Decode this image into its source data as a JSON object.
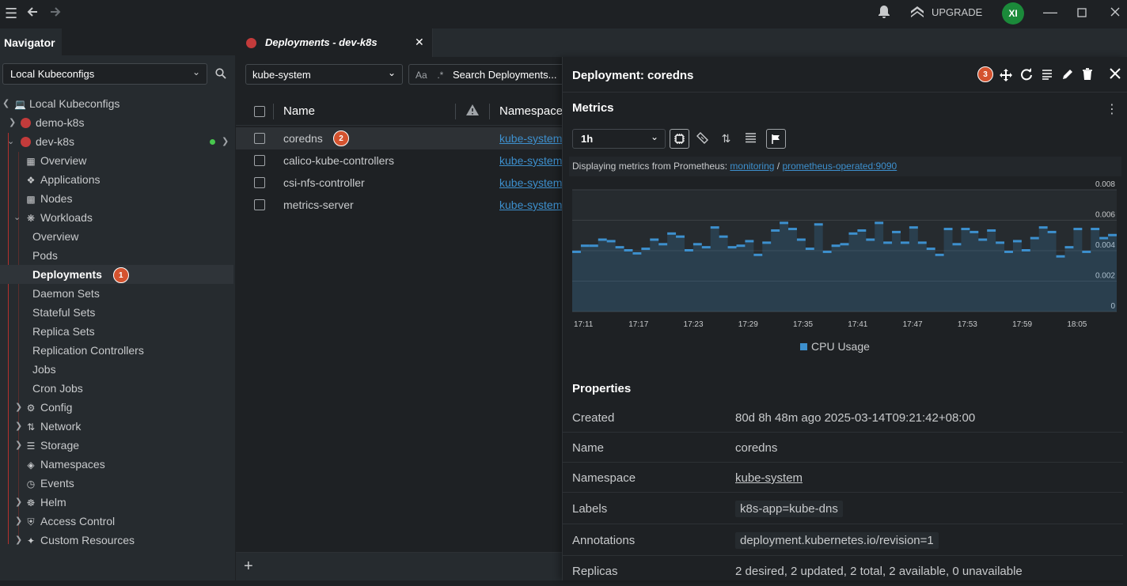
{
  "topbar": {
    "upgrade_label": "UPGRADE",
    "avatar_initials": "XI"
  },
  "navigator": {
    "tab_label": "Navigator",
    "kubeconfig_select": "Local Kubeconfigs",
    "tree": {
      "root": "Local Kubeconfigs",
      "cluster1": "demo-k8s",
      "cluster2": "dev-k8s",
      "overview": "Overview",
      "applications": "Applications",
      "nodes": "Nodes",
      "workloads": "Workloads",
      "workloads_items": [
        "Overview",
        "Pods",
        "Deployments",
        "Daemon Sets",
        "Stateful Sets",
        "Replica Sets",
        "Replication Controllers",
        "Jobs",
        "Cron Jobs"
      ],
      "config": "Config",
      "network": "Network",
      "storage": "Storage",
      "namespaces": "Namespaces",
      "events": "Events",
      "helm": "Helm",
      "access_control": "Access Control",
      "custom_resources": "Custom Resources"
    },
    "badge": "1"
  },
  "main": {
    "tab_label": "Deployments - dev-k8s",
    "namespace_select": "kube-system",
    "search_placeholder": "Search Deployments...",
    "search_prefix": "Aa",
    "columns": {
      "name": "Name",
      "namespace": "Namespace"
    },
    "rows": [
      {
        "name": "coredns",
        "namespace": "kube-system"
      },
      {
        "name": "calico-kube-controllers",
        "namespace": "kube-system"
      },
      {
        "name": "csi-nfs-controller",
        "namespace": "kube-system"
      },
      {
        "name": "metrics-server",
        "namespace": "kube-system"
      }
    ],
    "row_badge": "2"
  },
  "drawer": {
    "title": "Deployment: coredns",
    "badge": "3",
    "metrics_title": "Metrics",
    "range": "1h",
    "prom_prefix": "Displaying metrics from Prometheus: ",
    "prom_ns": "monitoring",
    "prom_sep": " / ",
    "prom_svc": "prometheus-operated:9090",
    "legend": "CPU Usage",
    "properties_title": "Properties",
    "properties": [
      {
        "key": "Created",
        "value": "80d 8h 48m ago 2025-03-14T09:21:42+08:00"
      },
      {
        "key": "Name",
        "value": "coredns"
      },
      {
        "key": "Namespace",
        "value": "kube-system"
      },
      {
        "key": "Labels",
        "value": "k8s-app=kube-dns"
      },
      {
        "key": "Annotations",
        "value": "deployment.kubernetes.io/revision=1"
      },
      {
        "key": "Replicas",
        "value": "2 desired, 2 updated, 2 total, 2 available, 0 unavailable"
      }
    ]
  },
  "chart_data": {
    "type": "area",
    "series_color": "#3d90ce",
    "x_ticks": [
      "17:11",
      "17:17",
      "17:23",
      "17:29",
      "17:35",
      "17:41",
      "17:47",
      "17:53",
      "17:59",
      "18:05"
    ],
    "y_ticks": [
      "0",
      "0.002",
      "0.004",
      "0.006",
      "0.008"
    ],
    "ylim": [
      0,
      0.008
    ],
    "legend": "CPU Usage",
    "values": [
      0.0039,
      0.0043,
      0.0043,
      0.0047,
      0.0046,
      0.0042,
      0.004,
      0.0038,
      0.0041,
      0.0047,
      0.0044,
      0.0051,
      0.0049,
      0.004,
      0.0044,
      0.0042,
      0.0055,
      0.0049,
      0.0042,
      0.0043,
      0.0046,
      0.0037,
      0.0045,
      0.0053,
      0.0058,
      0.0054,
      0.0047,
      0.0041,
      0.0057,
      0.0039,
      0.0043,
      0.0044,
      0.0051,
      0.0053,
      0.0047,
      0.0058,
      0.0045,
      0.0052,
      0.0045,
      0.0055,
      0.0045,
      0.0041,
      0.0037,
      0.0054,
      0.0044,
      0.0054,
      0.0052,
      0.0047,
      0.0053,
      0.0045,
      0.0039,
      0.0046,
      0.004,
      0.0048,
      0.0055,
      0.0052,
      0.0036,
      0.0042,
      0.0054,
      0.0039,
      0.0054,
      0.0048,
      0.005
    ]
  }
}
